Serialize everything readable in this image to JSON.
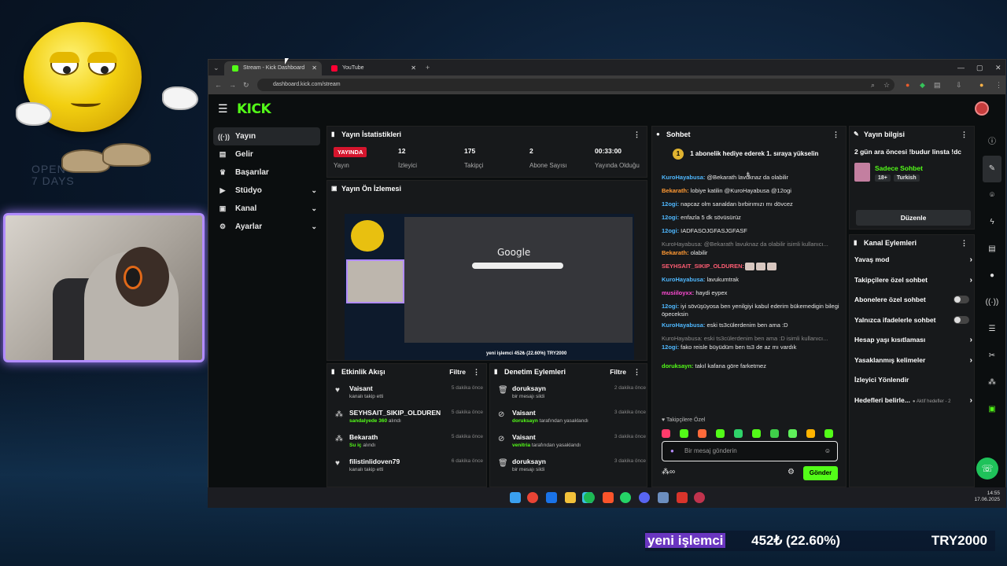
{
  "background": {
    "text_line1": "OPEN",
    "text_line2": "7 DAYS"
  },
  "browser": {
    "tabs": [
      {
        "label": "Stream - Kick Dashboard",
        "active": true,
        "fav_color": "#53fc18"
      },
      {
        "label": "YouTube",
        "active": false,
        "fav_color": "#ff0033"
      }
    ],
    "url": "dashboard.kick.com/stream"
  },
  "kick": {
    "logo": "KICK",
    "sidebar": [
      {
        "label": "Yayın",
        "icon": "broadcast-icon",
        "active": true
      },
      {
        "label": "Gelir",
        "icon": "wallet-icon"
      },
      {
        "label": "Başarılar",
        "icon": "trophy-icon"
      },
      {
        "label": "Stüdyo",
        "icon": "studio-icon",
        "expand": true
      },
      {
        "label": "Kanal",
        "icon": "channel-icon",
        "expand": true
      },
      {
        "label": "Ayarlar",
        "icon": "gear-icon",
        "expand": true
      }
    ],
    "stats": {
      "title": "Yayın İstatistikleri",
      "live_badge": "YAYINDA",
      "items": [
        {
          "value": "",
          "label": "Yayın"
        },
        {
          "value": "12",
          "label": "İzleyici"
        },
        {
          "value": "175",
          "label": "Takipçi"
        },
        {
          "value": "2",
          "label": "Abone Sayısı"
        },
        {
          "value": "00:33:00",
          "label": "Yayında Olduğu"
        }
      ]
    },
    "preview": {
      "title": "Yayın Ön İzlemesi",
      "google": "Google",
      "ticker": "yeni işlemci 452₺ (22.60%)   TRY2000"
    },
    "activity": {
      "title": "Etkinlik Akışı",
      "filter": "Filtre",
      "rows": [
        {
          "name": "Vaisant",
          "desc_pre": "",
          "desc_hl": "",
          "desc": "kanalı takip etti",
          "time": "5 dakika önce",
          "icon": "heart-icon"
        },
        {
          "name": "SEYHSAIT_SIKIP_OLDUREN",
          "desc_pre": "",
          "desc_hl": "sandalyede 360",
          "desc": " alındı",
          "time": "5 dakika önce",
          "icon": "reward-icon"
        },
        {
          "name": "Bekarath",
          "desc_pre": "",
          "desc_hl": "Su iç",
          "desc": " alındı",
          "time": "5 dakika önce",
          "icon": "reward-icon"
        },
        {
          "name": "filistinlidoven79",
          "desc_pre": "",
          "desc_hl": "",
          "desc": "kanalı takip etti",
          "time": "6 dakika önce",
          "icon": "heart-icon"
        }
      ]
    },
    "moderation": {
      "title": "Denetim Eylemleri",
      "filter": "Filtre",
      "rows": [
        {
          "name": "doruksayn",
          "desc_hl": "",
          "desc": "bir mesajı sildi",
          "time": "2 dakika önce",
          "icon": "trash-icon"
        },
        {
          "name": "Vaisant",
          "desc_hl": "doruksayn",
          "desc": " tarafından yasaklandı",
          "time": "3 dakika önce",
          "icon": "ban-icon"
        },
        {
          "name": "Vaisant",
          "desc_hl": "venitria",
          "desc": " tarafından yasaklandı",
          "time": "3 dakika önce",
          "icon": "ban-icon"
        },
        {
          "name": "doruksayn",
          "desc_hl": "",
          "desc": "bir mesajı sildi",
          "time": "3 dakika önce",
          "icon": "trash-icon"
        }
      ]
    },
    "chat": {
      "title": "Sohbet",
      "banner_count": "1",
      "banner": "1 abonelik hediye ederek 1. sıraya yükselin",
      "messages": [
        {
          "user": "KuroHayabusa:",
          "cls": "u-b",
          "text": " @Bekarath lavuknaz da olabilir"
        },
        {
          "user": "Bekarath:",
          "cls": "u-o",
          "text": " lobiye katilin @KuroHayabusa @12ogi"
        },
        {
          "user": "12ogi:",
          "cls": "u-b",
          "text": " napcaz olm sanaldan bırbirımızı mı dövcez"
        },
        {
          "user": "12ogi:",
          "cls": "u-b",
          "text": " enfazla 5 dk sövüsürüz"
        },
        {
          "user": "12ogi:",
          "cls": "u-b",
          "text": " IADFASOJGFASJGFASF"
        },
        {
          "user": "Bekarath:",
          "cls": "u-o",
          "text": " olabilir",
          "reply": "KuroHayabusa: @Bekarath lavuknaz da olabilir isimli kullanıcı..."
        },
        {
          "user": "SEYHSAIT_SIKIP_OLDUREN:",
          "cls": "u-r",
          "text": ""
        },
        {
          "user": "KuroHayabusa:",
          "cls": "u-b",
          "text": " lavukumtrak"
        },
        {
          "user": "musiiloyxx:",
          "cls": "u-p",
          "text": " haydi eypex"
        },
        {
          "user": "12ogi:",
          "cls": "u-b",
          "text": " iyi sövüşüyosa ben yenilgiyi kabul ederim bükemedigin bilegi öpeceksin"
        },
        {
          "user": "KuroHayabusa:",
          "cls": "u-b",
          "text": " eski ts3cülerdenim ben ama :D"
        },
        {
          "user": "12ogi:",
          "cls": "u-b",
          "text": " fako reisle büyüdüm ben ts3 de az mı vardık",
          "reply": "KuroHayabusa: eski ts3cülerdenim ben ama :D isimli kullanıcı..."
        },
        {
          "user": "doruksayn:",
          "cls": "u-g",
          "text": " takıl kafana göre farketmez"
        }
      ],
      "followers_only": "Takipçilere Özel",
      "input_placeholder": "Bir mesaj gönderin",
      "send": "Gönder"
    },
    "stream_info": {
      "title": "Yayın bilgisi",
      "stream_title": "2 gün ara öncesi !budur linsta !dc",
      "category": "Sadece Sohbet",
      "tags": [
        "18+",
        "Turkish"
      ],
      "edit": "Düzenle"
    },
    "channel_actions": {
      "title": "Kanal Eylemleri",
      "items": [
        {
          "label": "Yavaş mod",
          "kind": "chev"
        },
        {
          "label": "Takipçilere özel sohbet",
          "kind": "chev"
        },
        {
          "label": "Abonelere özel sohbet",
          "kind": "toggle"
        },
        {
          "label": "Yalnızca ifadelerle sohbet",
          "kind": "toggle"
        },
        {
          "label": "Hesap yaşı kısıtlaması",
          "kind": "chev"
        },
        {
          "label": "Yasaklanmış kelimeler",
          "kind": "chev"
        },
        {
          "label": "İzleyici Yönlendir",
          "kind": "none"
        },
        {
          "label": "Hedefleri belirle...",
          "kind": "chev",
          "extra": "● Aktif hedefler - 2"
        }
      ]
    }
  },
  "taskbar": {
    "time": "14:55",
    "date": "17.06.2025"
  },
  "overlay_ticker": {
    "highlight": "yeni işlemci",
    "price": "452₺ (22.60%)",
    "target": "TRY2000"
  },
  "colors": {
    "kick_green": "#53fc18",
    "live_red": "#d5152d",
    "cam_border": "#b28cff"
  }
}
